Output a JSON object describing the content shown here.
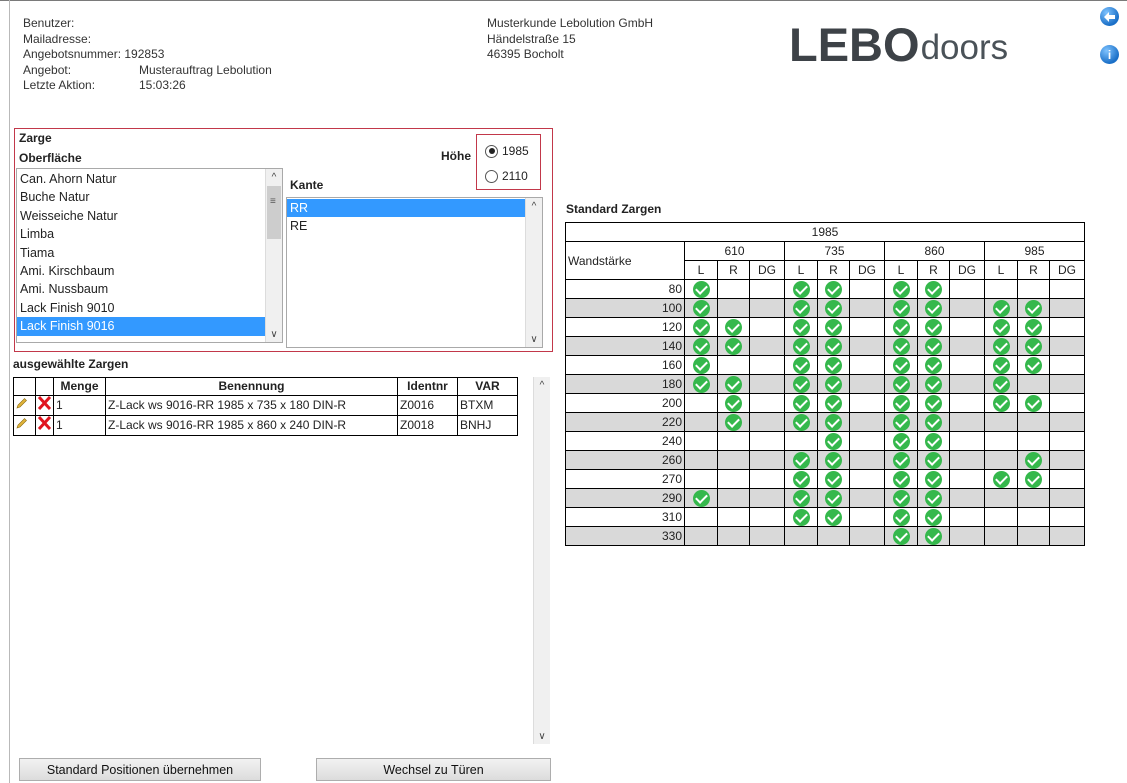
{
  "info": {
    "benutzer_label": "Benutzer:",
    "mail_label": "Mailadresse:",
    "angebotsnummer": "Angebotsnummer: 192853",
    "angebot_label": "Angebot:",
    "angebot_value": "Musterauftrag Lebolution",
    "letzte_label": "Letzte Aktion:",
    "letzte_value": "15:03:26"
  },
  "customer": {
    "name": "Musterkunde Lebolution GmbH",
    "street": "Händelstraße 15",
    "city": "46395 Bocholt"
  },
  "logo": {
    "bold": "LEBO",
    "light": "doors"
  },
  "icons": {
    "back": "back-arrow-icon",
    "info": "info-icon",
    "info_glyph": "i",
    "back_glyph": "⬅"
  },
  "zarge": {
    "title": "Zarge",
    "oberflaeche_label": "Oberfläche",
    "hoehe_label": "Höhe",
    "hoehe_options": [
      "1985",
      "2110"
    ],
    "hoehe_selected": "1985",
    "oberflaechen": [
      "Can. Ahorn Natur",
      "Buche Natur",
      "Weisseiche Natur",
      "Limba",
      "Tiama",
      "Ami. Kirschbaum",
      "Ami. Nussbaum",
      "Lack Finish 9010",
      "Lack Finish 9016"
    ],
    "oberflaeche_selected": "Lack Finish 9016",
    "kante_label": "Kante",
    "kanten": [
      "RR",
      "RE"
    ],
    "kante_selected": "RR"
  },
  "selected": {
    "title": "ausgewählte Zargen",
    "headers": [
      "",
      "",
      "Menge",
      "Benennung",
      "Identnr",
      "VAR"
    ],
    "rows": [
      {
        "menge": "1",
        "benennung": "Z-Lack ws 9016-RR 1985 x 735 x 180 DIN-R",
        "identnr": "Z0016",
        "var": "BTXM"
      },
      {
        "menge": "1",
        "benennung": "Z-Lack ws 9016-RR 1985 x 860 x 240 DIN-R",
        "identnr": "Z0018",
        "var": "BNHJ"
      }
    ]
  },
  "standard": {
    "title": "Standard Zargen",
    "height": "1985",
    "wandstaerke_label": "Wandstärke",
    "widths": [
      "610",
      "735",
      "860",
      "985"
    ],
    "sub": [
      "L",
      "R",
      "DG"
    ],
    "rows": [
      {
        "ws": "80",
        "c": [
          1,
          0,
          0,
          1,
          1,
          0,
          1,
          1,
          0,
          0,
          0,
          0
        ]
      },
      {
        "ws": "100",
        "c": [
          1,
          0,
          0,
          1,
          1,
          0,
          1,
          1,
          0,
          1,
          1,
          0
        ]
      },
      {
        "ws": "120",
        "c": [
          1,
          1,
          0,
          1,
          1,
          0,
          1,
          1,
          0,
          1,
          1,
          0
        ]
      },
      {
        "ws": "140",
        "c": [
          1,
          1,
          0,
          1,
          1,
          0,
          1,
          1,
          0,
          1,
          1,
          0
        ]
      },
      {
        "ws": "160",
        "c": [
          1,
          0,
          0,
          1,
          1,
          0,
          1,
          1,
          0,
          1,
          1,
          0
        ]
      },
      {
        "ws": "180",
        "c": [
          1,
          1,
          0,
          1,
          1,
          0,
          1,
          1,
          0,
          1,
          0,
          0
        ]
      },
      {
        "ws": "200",
        "c": [
          0,
          1,
          0,
          1,
          1,
          0,
          1,
          1,
          0,
          1,
          1,
          0
        ]
      },
      {
        "ws": "220",
        "c": [
          0,
          1,
          0,
          1,
          1,
          0,
          1,
          1,
          0,
          0,
          0,
          0
        ]
      },
      {
        "ws": "240",
        "c": [
          0,
          0,
          0,
          0,
          1,
          0,
          1,
          1,
          0,
          0,
          0,
          0
        ]
      },
      {
        "ws": "260",
        "c": [
          0,
          0,
          0,
          1,
          1,
          0,
          1,
          1,
          0,
          0,
          1,
          0
        ]
      },
      {
        "ws": "270",
        "c": [
          0,
          0,
          0,
          1,
          1,
          0,
          1,
          1,
          0,
          1,
          1,
          0
        ]
      },
      {
        "ws": "290",
        "c": [
          1,
          0,
          0,
          1,
          1,
          0,
          1,
          1,
          0,
          0,
          0,
          0
        ]
      },
      {
        "ws": "310",
        "c": [
          0,
          0,
          0,
          1,
          1,
          0,
          1,
          1,
          0,
          0,
          0,
          0
        ]
      },
      {
        "ws": "330",
        "c": [
          0,
          0,
          0,
          0,
          0,
          0,
          1,
          1,
          0,
          0,
          0,
          0
        ]
      }
    ]
  },
  "buttons": {
    "standard": "Standard Positionen übernehmen",
    "wechsel": "Wechsel zu Türen"
  }
}
